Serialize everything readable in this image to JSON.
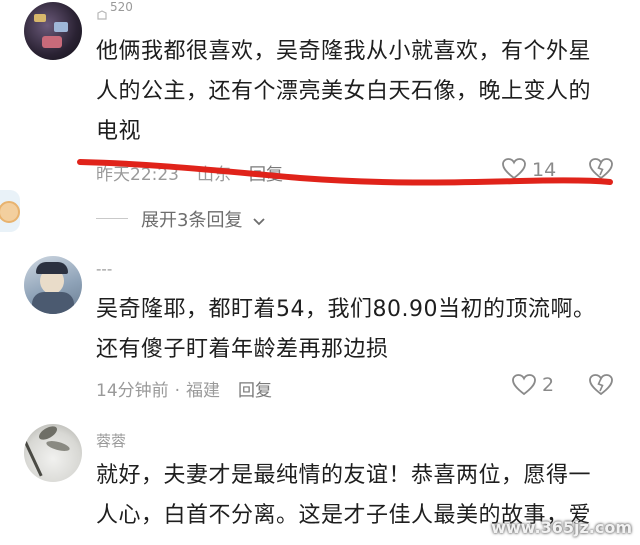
{
  "comments": [
    {
      "username": "520",
      "text_lines": [
        "他俩我都很喜欢，吴奇隆我从小就喜欢，有个外星",
        "人的公主，还有个漂亮美女白天石像，晚上变人的",
        "电视"
      ],
      "time": "昨天22:23",
      "location": "山东",
      "reply_label": "回复",
      "likes": "14"
    },
    {
      "username": "---",
      "text_lines": [
        "吴奇隆耶，都盯着54，我们80.90当初的顶流啊。",
        "还有傻子盯着年龄差再那边损"
      ],
      "time": "14分钟前",
      "location": "福建",
      "reply_label": "回复",
      "likes": "2"
    },
    {
      "username": "蓉蓉",
      "text_lines": [
        "就好，夫妻才是最纯情的友谊！恭喜两位，愿得一",
        "人心，白首不分离。这是才子佳人最美的故事，爱"
      ]
    }
  ],
  "expand_replies": "展开3条回复",
  "watermark": "www.365jz.com",
  "colors": {
    "annotation_line": "#e0231a",
    "meta_gray": "#9a9a9a"
  }
}
